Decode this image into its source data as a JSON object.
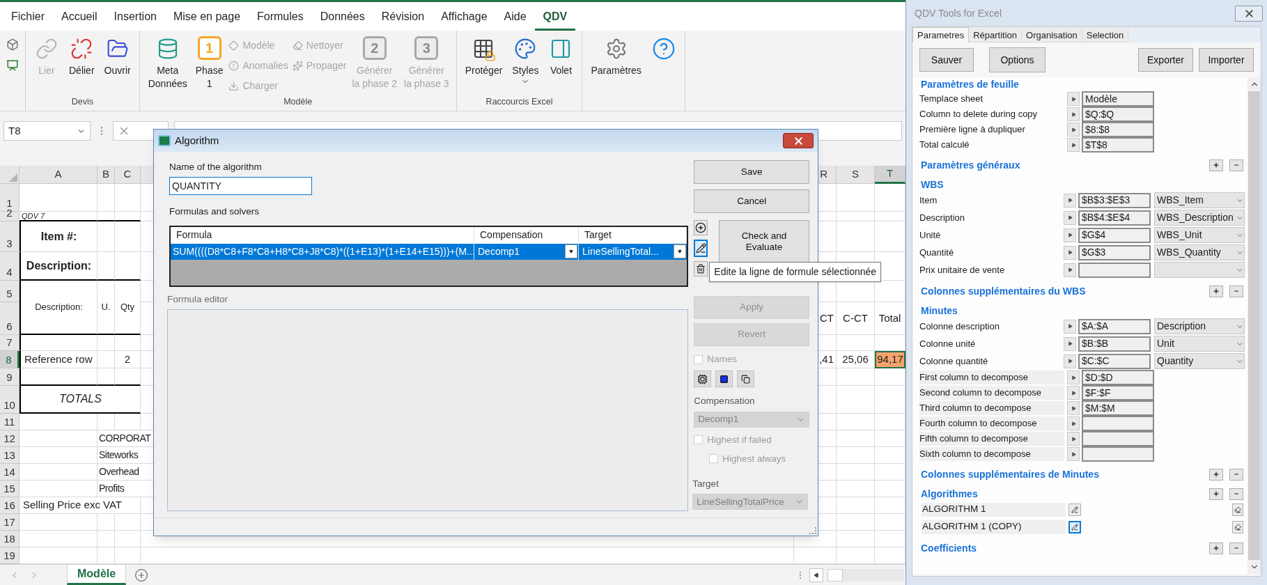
{
  "ribbon": {
    "tabs": [
      {
        "label": "Fichier",
        "selected": false
      },
      {
        "label": "Accueil",
        "selected": false
      },
      {
        "label": "Insertion",
        "selected": false
      },
      {
        "label": "Mise en page",
        "selected": false
      },
      {
        "label": "Formules",
        "selected": false
      },
      {
        "label": "Données",
        "selected": false
      },
      {
        "label": "Révision",
        "selected": false
      },
      {
        "label": "Affichage",
        "selected": false
      },
      {
        "label": "Aide",
        "selected": false
      },
      {
        "label": "QDV",
        "selected": true
      }
    ],
    "groups": [
      {
        "items": [
          {
            "kind": "icons"
          }
        ]
      },
      {
        "label": "Devis",
        "items": [
          {
            "kind": "large",
            "lines": [
              "Lier"
            ],
            "disabled": true
          },
          {
            "kind": "large",
            "lines": [
              "Délier"
            ],
            "disabled": false
          },
          {
            "kind": "large",
            "lines": [
              "Ouvrir"
            ],
            "disabled": false
          }
        ]
      },
      {
        "label": "Modèle",
        "items": [
          {
            "kind": "large",
            "lines": [
              "Meta",
              "Données"
            ],
            "disabled": false
          },
          {
            "kind": "numbered",
            "badge": "1",
            "lines": [
              "Phase",
              "1"
            ],
            "disabled": false
          },
          {
            "kind": "stack",
            "items": [
              {
                "label": "Modèle",
                "disabled": true
              },
              {
                "label": "Anomalies",
                "disabled": true
              },
              {
                "label": "Charger",
                "disabled": true
              }
            ]
          },
          {
            "kind": "stack",
            "items": [
              {
                "label": "Nettoyer",
                "disabled": true
              },
              {
                "label": "Propager",
                "disabled": true
              }
            ]
          },
          {
            "kind": "numbered",
            "badge": "2",
            "lines": [
              "Générer",
              "la phase 2"
            ],
            "disabled": true
          },
          {
            "kind": "numbered",
            "badge": "3",
            "lines": [
              "Générer",
              "la phase 3"
            ],
            "disabled": true
          }
        ]
      },
      {
        "label": "Raccourcis Excel",
        "items": [
          {
            "kind": "large",
            "lines": [
              "Protéger"
            ],
            "disabled": false
          },
          {
            "kind": "large",
            "lines": [
              "Styles"
            ],
            "disabled": false,
            "menu": true
          },
          {
            "kind": "large",
            "lines": [
              "Volet"
            ],
            "disabled": false
          }
        ]
      },
      {
        "items": [
          {
            "kind": "large",
            "lines": [
              "Paramètres"
            ],
            "disabled": false
          },
          {
            "kind": "large",
            "disabled": false
          }
        ]
      }
    ]
  },
  "name_box": "T8",
  "sheet": {
    "columns": [
      {
        "label": "A",
        "selected": false
      },
      {
        "label": "B",
        "selected": false
      },
      {
        "label": "C",
        "selected": false
      },
      {
        "label": "R",
        "selected": false
      },
      {
        "label": "S",
        "selected": false
      },
      {
        "label": "T",
        "selected": true
      }
    ],
    "rows": [
      {
        "header": "1",
        "selected": false
      },
      {
        "header": "2",
        "selected": false,
        "a": {
          "text": "QDV 7"
        }
      },
      {
        "header": "3",
        "selected": false,
        "a": {
          "text": "Item #:"
        }
      },
      {
        "header": "4",
        "selected": false,
        "a": {
          "text": "Description:"
        }
      },
      {
        "header": "5",
        "selected": false,
        "a": {
          "text": "Description:"
        },
        "b": {
          "text": "U."
        },
        "c": {
          "text": "Qty"
        }
      },
      {
        "header": "6",
        "selected": false,
        "r": {
          "text": "CT"
        },
        "s": {
          "text": "C-CT"
        },
        "t": {
          "text": "Total"
        }
      },
      {
        "header": "7",
        "selected": false
      },
      {
        "header": "8",
        "selected": true,
        "a": {
          "text": "Reference row"
        },
        "c": {
          "text": "2"
        },
        "r": {
          "text": ",41"
        },
        "s": {
          "text": "25,06"
        },
        "t": {
          "text": "94,17",
          "selected": true,
          "color": "#f4a46c"
        }
      },
      {
        "header": "9",
        "selected": false
      },
      {
        "header": "10",
        "selected": false,
        "a": {
          "text": "TOTALS"
        }
      },
      {
        "header": "11",
        "selected": false
      },
      {
        "header": "12",
        "selected": false,
        "b": {
          "text": "CORPORAT"
        }
      },
      {
        "header": "13",
        "selected": false,
        "b": {
          "text": "Siteworks"
        }
      },
      {
        "header": "14",
        "selected": false,
        "b": {
          "text": "Overhead"
        }
      },
      {
        "header": "15",
        "selected": false,
        "b": {
          "text": "Profits"
        }
      },
      {
        "header": "16",
        "selected": false,
        "a": {
          "text": "Selling Price  exc VAT"
        }
      },
      {
        "header": "17",
        "selected": false
      },
      {
        "header": "18",
        "selected": false
      },
      {
        "header": "19",
        "selected": false
      }
    ]
  },
  "sheet_tabs": [
    {
      "label": "Modèle",
      "selected": true
    }
  ],
  "dialog": {
    "title": "Algorithm",
    "name_label": "Name of the algorithm",
    "name_value": "QUANTITY",
    "formulas_label": "Formulas and solvers",
    "grid": {
      "columns": [
        "Formula",
        "Compensation",
        "Target"
      ],
      "rows": [
        {
          "formula": "SUM((((D8*C8+F8*C8+H8*C8+J8*C8)*((1+E13)*(1+E14+E15)))+(M...",
          "compensation": "Decomp1",
          "target": "LineSellingTotal...",
          "selected": true
        }
      ]
    },
    "editor_label": "Formula editor",
    "save": "Save",
    "cancel": "Cancel",
    "check": "Check and Evaluate",
    "apply": {
      "label": "Apply",
      "disabled": true
    },
    "revert": {
      "label": "Revert",
      "disabled": true
    },
    "names": {
      "label": "Names",
      "checked": false,
      "disabled": true
    },
    "compensation_label": "Compensation",
    "compensation": {
      "value": "Decomp1",
      "disabled": true
    },
    "highest_if_failed": {
      "label": "Highest if failed",
      "checked": false,
      "disabled": true
    },
    "highest_always": {
      "label": "Highest always",
      "checked": false,
      "disabled": true
    },
    "target_label": "Target",
    "target": {
      "value": "LineSellingTotalPrice",
      "disabled": true
    },
    "tooltip": "Edite la ligne de formule sélectionnée"
  },
  "panel": {
    "title": "QDV Tools for Excel",
    "tabs": [
      {
        "label": "Parametres",
        "selected": true
      },
      {
        "label": "Répartition",
        "selected": false
      },
      {
        "label": "Organisation",
        "selected": false
      },
      {
        "label": "Selection",
        "selected": false
      }
    ],
    "buttons": [
      "Sauver",
      "Options",
      "Exporter",
      "Importer"
    ],
    "sections": [
      {
        "title": "Paramètres de feuille",
        "add_remove": false,
        "rows": [
          {
            "kind": "field",
            "label": "Templace sheet",
            "value": "Modèle"
          },
          {
            "kind": "field",
            "label": "Column to delete during copy",
            "value": "$Q:$Q"
          },
          {
            "kind": "field",
            "label": "Première ligne à dupliquer",
            "value": "$8:$8"
          },
          {
            "kind": "field",
            "label": "Total calculé",
            "value": "$T$8"
          }
        ]
      },
      {
        "title": "Paramètres généraux",
        "add_remove": true
      },
      {
        "title": "WBS",
        "add_remove": false,
        "rows": [
          {
            "kind": "field",
            "label": "Item",
            "value": "$B$3:$E$3",
            "dropdown": {
              "value": "WBS_Item"
            }
          },
          {
            "kind": "field",
            "label": "Description",
            "value": "$B$4:$E$4",
            "dropdown": {
              "value": "WBS_Description"
            }
          },
          {
            "kind": "field",
            "label": "Unité",
            "value": "$G$4",
            "dropdown": {
              "value": "WBS_Unit"
            }
          },
          {
            "kind": "field",
            "label": "Quantité",
            "value": "$G$3",
            "dropdown": {
              "value": "WBS_Quantity"
            }
          },
          {
            "kind": "field",
            "label": "Prix unitaire de vente",
            "dropdown": {}
          }
        ]
      },
      {
        "title": "Colonnes supplémentaires du WBS",
        "add_remove": true
      },
      {
        "title": "Minutes",
        "add_remove": false,
        "rows": [
          {
            "kind": "field",
            "label": "Colonne description",
            "value": "$A:$A",
            "dropdown": {
              "value": "Description"
            }
          },
          {
            "kind": "field",
            "label": "Colonne unité",
            "value": "$B:$B",
            "dropdown": {
              "value": "Unit"
            }
          },
          {
            "kind": "field",
            "label": "Colonne quantité",
            "value": "$C:$C",
            "dropdown": {
              "value": "Quantity"
            }
          },
          {
            "kind": "decompose",
            "label": "First column to decompose",
            "value": "$D:$D"
          },
          {
            "kind": "decompose",
            "label": "Second column to decompose",
            "value": "$F:$F"
          },
          {
            "kind": "decompose",
            "label": "Third column to decompose",
            "value": "$M:$M"
          },
          {
            "kind": "decompose",
            "label": "Fourth column to decompose"
          },
          {
            "kind": "decompose",
            "label": "Fifth column to decompose"
          },
          {
            "kind": "decompose",
            "label": "Sixth column to decompose"
          }
        ]
      },
      {
        "title": "Colonnes supplémentaires de Minutes",
        "add_remove": true
      },
      {
        "title": "Algorithmes",
        "add_remove": true,
        "rows": [
          {
            "kind": "algorithm",
            "label": "ALGORITHM 1",
            "selected": false
          },
          {
            "kind": "algorithm",
            "label": "ALGORITHM 1 (COPY)",
            "selected": true
          }
        ]
      },
      {
        "title": "Coefficients",
        "add_remove": true
      }
    ]
  }
}
